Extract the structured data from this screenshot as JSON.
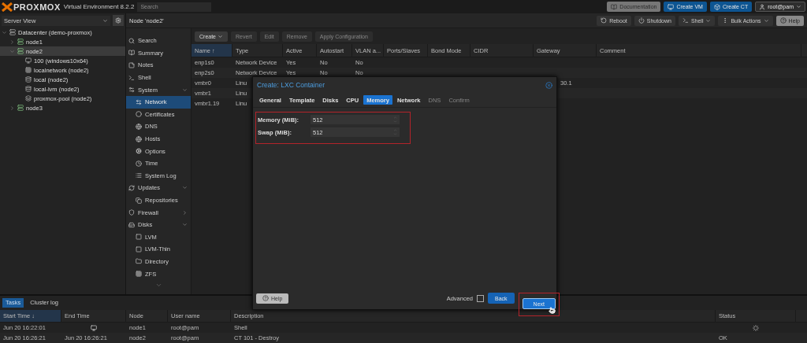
{
  "header": {
    "logo": "PROXMOX",
    "product": "Virtual Environment 8.2.2",
    "search_placeholder": "Search",
    "buttons": [
      {
        "label": "Documentation",
        "kind": "docs"
      },
      {
        "label": "Create VM",
        "kind": "vm"
      },
      {
        "label": "Create CT",
        "kind": "ct"
      },
      {
        "label": "root@pam",
        "kind": "user"
      }
    ]
  },
  "tree": {
    "view": "Server View",
    "items": [
      {
        "label": "Datacenter (demo-proxmox)",
        "kind": "datacenter",
        "expanded": true,
        "selected": false,
        "children": [
          {
            "label": "node1",
            "kind": "node",
            "expanded": false,
            "selected": false
          },
          {
            "label": "node2",
            "kind": "node",
            "expanded": true,
            "selected": true,
            "children": [
              {
                "label": "100 (windows10x64)",
                "kind": "vm",
                "selected": false
              },
              {
                "label": "localnetwork (node2)",
                "kind": "network",
                "selected": false
              },
              {
                "label": "local (node2)",
                "kind": "storage",
                "selected": false
              },
              {
                "label": "local-lvm (node2)",
                "kind": "storage",
                "selected": false
              },
              {
                "label": "proxmox-pool (node2)",
                "kind": "pool",
                "selected": false
              }
            ]
          },
          {
            "label": "node3",
            "kind": "node",
            "expanded": false,
            "selected": false
          }
        ]
      }
    ]
  },
  "node_panel": {
    "title": "Node 'node2'",
    "actions": [
      {
        "label": "Reboot",
        "kind": "reboot"
      },
      {
        "label": "Shutdown",
        "kind": "shutdown"
      },
      {
        "label": "Shell",
        "kind": "shell"
      },
      {
        "label": "Bulk Actions",
        "kind": "bulk"
      },
      {
        "label": "Help",
        "kind": "help"
      }
    ]
  },
  "nav": [
    {
      "label": "Search",
      "kind": "search",
      "selected": false
    },
    {
      "label": "Summary",
      "kind": "summary",
      "selected": false
    },
    {
      "label": "Notes",
      "kind": "notes",
      "selected": false
    },
    {
      "label": "Shell",
      "kind": "shell",
      "selected": false
    },
    {
      "label": "System",
      "kind": "system",
      "selected": false,
      "expanded": true,
      "children": [
        {
          "label": "Network",
          "kind": "network",
          "selected": true
        },
        {
          "label": "Certificates",
          "kind": "cert",
          "selected": false
        },
        {
          "label": "DNS",
          "kind": "globe",
          "selected": false
        },
        {
          "label": "Hosts",
          "kind": "globe",
          "selected": false
        },
        {
          "label": "Options",
          "kind": "gear",
          "selected": false
        },
        {
          "label": "Time",
          "kind": "clock",
          "selected": false
        },
        {
          "label": "System Log",
          "kind": "log",
          "selected": false
        }
      ]
    },
    {
      "label": "Updates",
      "kind": "updates",
      "selected": false,
      "expanded": true,
      "children": [
        {
          "label": "Repositories",
          "kind": "repo",
          "selected": false
        }
      ]
    },
    {
      "label": "Firewall",
      "kind": "firewall",
      "selected": false,
      "expanded": false
    },
    {
      "label": "Disks",
      "kind": "disks",
      "selected": false,
      "expanded": true,
      "children": [
        {
          "label": "LVM",
          "kind": "lvm",
          "selected": false
        },
        {
          "label": "LVM-Thin",
          "kind": "lvmthin",
          "selected": false
        },
        {
          "label": "Directory",
          "kind": "folder",
          "selected": false
        },
        {
          "label": "ZFS",
          "kind": "zfs",
          "selected": false
        }
      ]
    }
  ],
  "network": {
    "toolbar": [
      {
        "label": "Create",
        "disabled": false,
        "menu": true
      },
      {
        "label": "Revert",
        "disabled": true,
        "menu": false
      },
      {
        "label": "Edit",
        "disabled": true,
        "menu": false
      },
      {
        "label": "Remove",
        "disabled": true,
        "menu": false
      },
      {
        "label": "Apply Configuration",
        "disabled": true,
        "menu": false
      }
    ],
    "columns": [
      {
        "label": "Name ↑",
        "sorted": true
      },
      {
        "label": "Type",
        "sorted": false
      },
      {
        "label": "Active",
        "sorted": false
      },
      {
        "label": "Autostart",
        "sorted": false
      },
      {
        "label": "VLAN a...",
        "sorted": false
      },
      {
        "label": "Ports/Slaves",
        "sorted": false
      },
      {
        "label": "Bond Mode",
        "sorted": false
      },
      {
        "label": "CIDR",
        "sorted": false
      },
      {
        "label": "Gateway",
        "sorted": false
      },
      {
        "label": "Comment",
        "sorted": false
      }
    ],
    "rows": [
      [
        "enp1s0",
        "Network Device",
        "Yes",
        "No",
        "No"
      ],
      [
        "enp2s0",
        "Network Device",
        "Yes",
        "No",
        "No"
      ],
      [
        "vmbr0",
        "Linu",
        null,
        null,
        null,
        null,
        null,
        null,
        "30.1"
      ],
      [
        "vmbr1",
        "Linu"
      ],
      [
        "vmbr1.19",
        "Linu"
      ]
    ]
  },
  "dialog": {
    "title": "Create: LXC Container",
    "tabs": [
      {
        "label": "General",
        "selected": false,
        "disabled": false
      },
      {
        "label": "Template",
        "selected": false,
        "disabled": false
      },
      {
        "label": "Disks",
        "selected": false,
        "disabled": false
      },
      {
        "label": "CPU",
        "selected": false,
        "disabled": false
      },
      {
        "label": "Memory",
        "selected": true,
        "disabled": false
      },
      {
        "label": "Network",
        "selected": false,
        "disabled": false
      },
      {
        "label": "DNS",
        "selected": false,
        "disabled": true
      },
      {
        "label": "Confirm",
        "selected": false,
        "disabled": true
      }
    ],
    "fields": [
      {
        "label": "Memory (MiB):",
        "value": "512"
      },
      {
        "label": "Swap (MiB):",
        "value": "512"
      }
    ],
    "help": "Help",
    "advanced": {
      "label": "Advanced",
      "checked": false
    },
    "back": "Back",
    "next": "Next"
  },
  "log": {
    "tabs": [
      {
        "label": "Tasks",
        "selected": true
      },
      {
        "label": "Cluster log",
        "selected": false
      }
    ],
    "columns": [
      {
        "label": "Start Time ↓",
        "sorted": true
      },
      {
        "label": "End Time",
        "sorted": false
      },
      {
        "label": "Node",
        "sorted": false
      },
      {
        "label": "User name",
        "sorted": false
      },
      {
        "label": "Description",
        "sorted": false
      },
      {
        "label": "Status",
        "sorted": false
      }
    ],
    "rows": [
      {
        "cells": [
          "Jun 20 16:22:01",
          null,
          "node1",
          "root@pam",
          "Shell"
        ],
        "running": true
      },
      {
        "cells": [
          "Jun 20 16:26:21",
          "Jun 20 16:26:21",
          "node2",
          "root@pam",
          "CT 101 - Destroy",
          "OK"
        ],
        "running": false
      }
    ]
  }
}
